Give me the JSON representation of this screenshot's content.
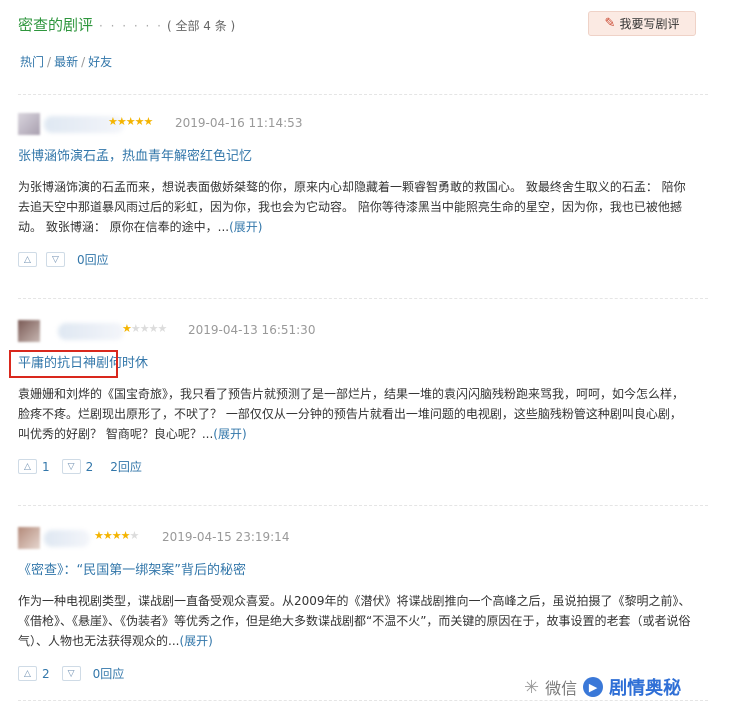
{
  "header": {
    "title": "密查的剧评",
    "dots": "· · · · · ·",
    "count": "( 全部 4 条 )"
  },
  "write_button": {
    "label": "我要写剧评"
  },
  "filters": [
    "热门",
    "最新",
    "好友"
  ],
  "filter_sep": "/",
  "reviews": [
    {
      "stars": 5,
      "stars_on": "★★★★★",
      "stars_off": "",
      "time": "2019-04-16 11:14:53",
      "title": "张博涵饰演石孟，热血青年解密红色记忆",
      "body": "为张博涵饰演的石孟而来，想说表面傲娇桀骜的你，原来内心却隐藏着一颗睿智勇敢的救国心。 致最终舍生取义的石孟： 陪你去追天空中那道暴风雨过后的彩虹，因为你，我也会为它动容。 陪你等待漆黑当中能照亮生命的星空，因为你，我也已被他撼动。 致张博涵： 原你在信奉的途中，...",
      "expand": "(展开)",
      "up": "△",
      "down": "▽",
      "up_count": "",
      "down_count": "",
      "reply": "0回应"
    },
    {
      "stars": 1,
      "stars_on": "★",
      "stars_off": "★★★★",
      "time": "2019-04-13 16:51:30",
      "title": "平庸的抗日神剧何时休",
      "body": "袁姗姗和刘烨的《国宝奇旅》，我只看了预告片就预测了是一部烂片，结果一堆的袁闪闪脑残粉跑来骂我，呵呵，如今怎么样，脸疼不疼。烂剧现出原形了，不吠了？ 一部仅仅从一分钟的预告片就看出一堆问题的电视剧，这些脑残粉管这种剧叫良心剧，叫优秀的好剧？ 智商呢？良心呢？...",
      "expand": "(展开)",
      "up": "△",
      "down": "▽",
      "up_count": "1",
      "down_count": "2",
      "reply": "2回应"
    },
    {
      "stars": 4,
      "stars_on": "★★★★",
      "stars_off": "★",
      "time": "2019-04-15 23:19:14",
      "title": "《密查》：“民国第一绑架案”背后的秘密",
      "body": "作为一种电视剧类型，谍战剧一直备受观众喜爱。从2009年的《潜伏》将谍战剧推向一个高峰之后，虽说拍摄了《黎明之前》、《借枪》、《悬崖》、《伪装者》等优秀之作，但是绝大多数谍战剧都“不温不火”，而关键的原因在于，故事设置的老套（或者说俗气）、人物也无法获得观众的...",
      "expand": "(展开)",
      "up": "△",
      "down": "▽",
      "up_count": "2",
      "down_count": "",
      "reply": "0回应"
    }
  ],
  "watermark": {
    "wechat": "微信",
    "brand": "剧情奥秘"
  },
  "colors": {
    "green": "#2e963d",
    "link": "#3377aa",
    "highlight": "#d9281d",
    "star": "#f4b400"
  }
}
